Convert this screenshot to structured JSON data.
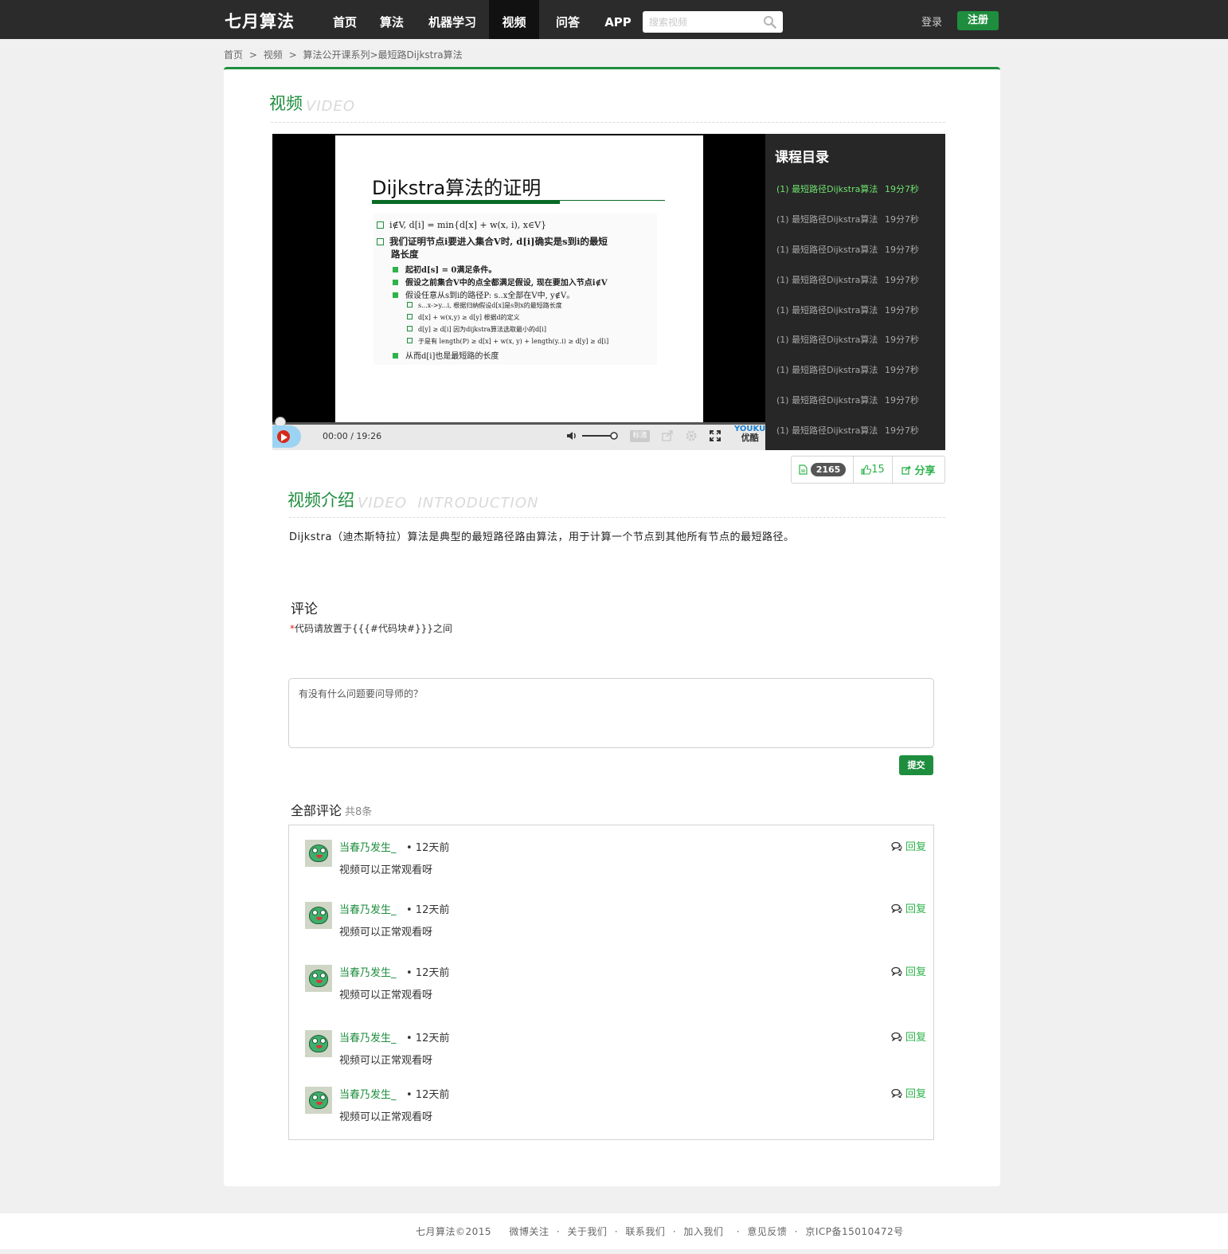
{
  "nav": {
    "logo": "七月算法",
    "items": [
      {
        "label": "首页"
      },
      {
        "label": "算法"
      },
      {
        "label": "机器学习"
      },
      {
        "label": "视频"
      },
      {
        "label": "问答"
      },
      {
        "label": "APP"
      }
    ],
    "active": "视频",
    "search_placeholder": "搜索视频",
    "login": "登录",
    "register": "注册"
  },
  "breadcrumb": [
    "首页",
    ">",
    "视频",
    ">",
    "算法公开课系列",
    ">",
    "最短路Dijkstra算法"
  ],
  "video_section": {
    "title_cn": "视频",
    "title_en": "VIDEO"
  },
  "slide": {
    "title": "Dijkstra算法的证明",
    "lines": [
      "i∉V, d[i] = min{d[x] + w(x, i), x∈V}",
      "我们证明节点i要进入集合V时, d[i]确实是s到i的最短",
      "路长度",
      "起初d[s] = 0满足条件。",
      "假设之前集合V中的点全都满足假设, 现在要加入节点i∉V",
      "假设任意从s到i的路径P: s..x全部在V中, y∉V。",
      "s...x->y...i, 根据归纳假设d[x]是s到x的最短路长度",
      "d[x] + w(x,y) ≥ d[y] 根据d的定义",
      "d[y] ≥ d[i] 因为dijkstra算法选取最小的d[i]",
      "于是有 length(P) ≥ d[x] + w(x, y) + length(y..i) ≥ d[y] ≥ d[i]",
      "从而d[i]也是最短路的长度"
    ]
  },
  "player": {
    "current_time": "00:00 /",
    "duration": "19:26",
    "progress": 0,
    "volume": 1.0,
    "quality_label": "标清",
    "brand_top": "YOUKU",
    "brand_bottom": "优酷"
  },
  "playlist": {
    "title": "课程目录",
    "items": [
      {
        "label": "(1) 最短路径Dijkstra算法",
        "duration": "19分7秒",
        "active": true
      },
      {
        "label": "(1) 最短路径Dijkstra算法",
        "duration": "19分7秒",
        "active": false
      },
      {
        "label": "(1) 最短路径Dijkstra算法",
        "duration": "19分7秒",
        "active": false
      },
      {
        "label": "(1) 最短路径Dijkstra算法",
        "duration": "19分7秒",
        "active": false
      },
      {
        "label": "(1) 最短路径Dijkstra算法",
        "duration": "19分7秒",
        "active": false
      },
      {
        "label": "(1) 最短路径Dijkstra算法",
        "duration": "19分7秒",
        "active": false
      },
      {
        "label": "(1) 最短路径Dijkstra算法",
        "duration": "19分7秒",
        "active": false
      },
      {
        "label": "(1) 最短路径Dijkstra算法",
        "duration": "19分7秒",
        "active": false
      },
      {
        "label": "(1) 最短路径Dijkstra算法",
        "duration": "19分7秒",
        "active": false
      }
    ]
  },
  "stats": {
    "views": "2165",
    "likes": "15",
    "share": "分享"
  },
  "intro_section": {
    "title_cn": "视频介绍",
    "title_en": "VIDEO  INTRODUCTION"
  },
  "intro_text": "Dijkstra（迪杰斯特拉）算法是典型的最短路径路由算法，用于计算一个节点到其他所有节点的最短路径。",
  "comment_form": {
    "heading": "评论",
    "required_mark": "*",
    "note": "代码请放置于{{{#代码块#}}}之间",
    "placeholder": "有没有什么问题要问导师的？",
    "submit": "提交"
  },
  "comments_header": {
    "title": "全部评论",
    "count": "共8条"
  },
  "comments": [
    {
      "author": "当春乃发生_",
      "time": "• 12天前",
      "text": "视频可以正常观看呀",
      "reply": "回复"
    },
    {
      "author": "当春乃发生_",
      "time": "• 12天前",
      "text": "视频可以正常观看呀",
      "reply": "回复"
    },
    {
      "author": "当春乃发生_",
      "time": "• 12天前",
      "text": "视频可以正常观看呀",
      "reply": "回复"
    },
    {
      "author": "当春乃发生_",
      "time": "• 12天前",
      "text": "视频可以正常观看呀",
      "reply": "回复"
    },
    {
      "author": "当春乃发生_",
      "time": "• 12天前",
      "text": "视频可以正常观看呀",
      "reply": "回复"
    }
  ],
  "footer": {
    "copyright": "七月算法©2015",
    "links": [
      "微博关注",
      "·",
      "关于我们",
      "·",
      "联系我们",
      "·",
      "加入我们",
      "·",
      "意见反馈",
      "·",
      "京ICP备15010472号"
    ]
  },
  "colors": {
    "brand_green": "#1e8e3e",
    "nav_bg": "#2b2b2b",
    "playlist_active": "#6ee36e"
  }
}
